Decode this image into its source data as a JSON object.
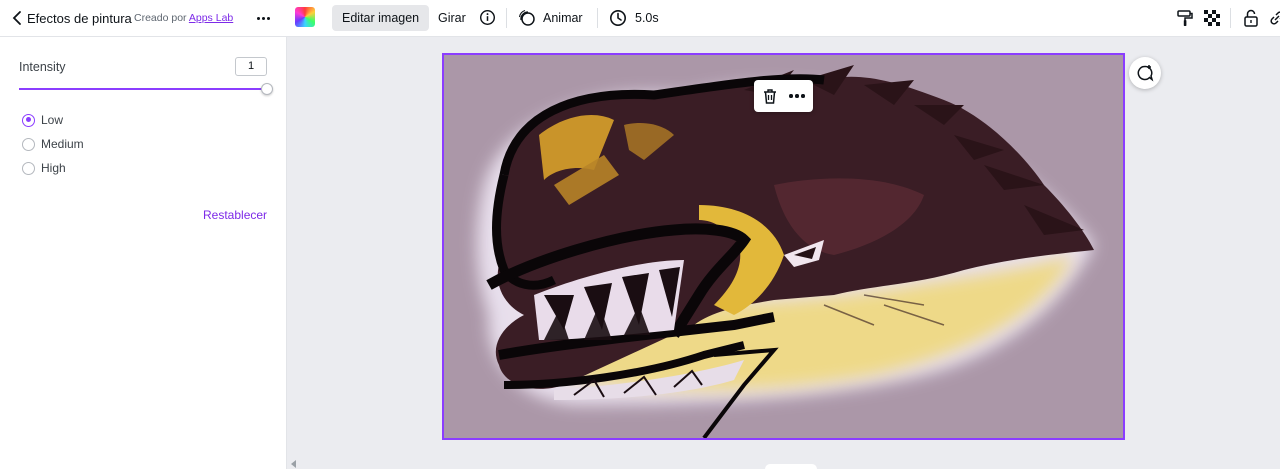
{
  "panel": {
    "title": "Efectos de pintura",
    "creator_prefix": "Creado por",
    "creator_name": "Apps Lab",
    "intensity_label": "Intensity",
    "intensity_value": "1",
    "slider_fraction": 1.0,
    "options": [
      {
        "label": "Low",
        "checked": true
      },
      {
        "label": "Medium",
        "checked": false
      },
      {
        "label": "High",
        "checked": false
      }
    ],
    "reset_label": "Restablecer"
  },
  "toolbar": {
    "edit_image": "Editar imagen",
    "rotate": "Girar",
    "animate": "Animar",
    "duration": "5.0s"
  },
  "colors": {
    "accent": "#8b3dff",
    "link": "#7d2ae8"
  },
  "icons": [
    "chevron-left-icon",
    "more-icon",
    "color-swatch",
    "info-icon",
    "animate-icon",
    "clock-icon",
    "paint-roller-icon",
    "transparency-icon",
    "lock-icon",
    "link-icon",
    "trash-icon",
    "comment-add-icon"
  ]
}
